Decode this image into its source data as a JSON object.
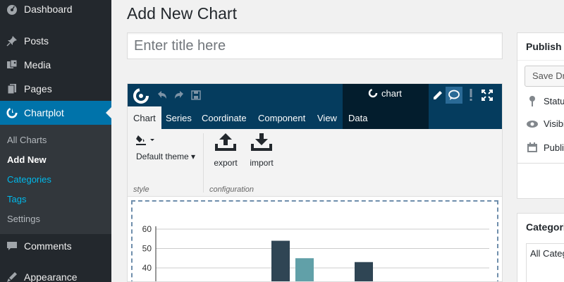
{
  "sidebar": {
    "items": [
      {
        "label": "Dashboard",
        "icon": "dashboard-icon"
      },
      {
        "label": "Posts",
        "icon": "pin-icon"
      },
      {
        "label": "Media",
        "icon": "media-icon"
      },
      {
        "label": "Pages",
        "icon": "pages-icon"
      },
      {
        "label": "Chartplot",
        "icon": "chartplot-icon"
      },
      {
        "label": "Comments",
        "icon": "comments-icon"
      },
      {
        "label": "Appearance",
        "icon": "appearance-icon"
      }
    ],
    "submenu": [
      "All Charts",
      "Add New",
      "Categories",
      "Tags",
      "Settings"
    ]
  },
  "page": {
    "title": "Add New Chart",
    "title_placeholder": "Enter title here"
  },
  "editor": {
    "tabs": [
      "Chart",
      "Series",
      "Coordinate",
      "Component",
      "View",
      "Data"
    ],
    "chart_tab_label": "chart",
    "ribbon": {
      "theme_label": "Default theme",
      "export_label": "export",
      "import_label": "import",
      "group_style": "style",
      "group_configuration": "configuration"
    }
  },
  "chart_data": {
    "type": "bar",
    "y_ticks": [
      40,
      50,
      60
    ],
    "ylim": [
      0,
      60
    ],
    "bars": [
      {
        "value": 54,
        "color": "#2f4554"
      },
      {
        "value": 45,
        "color": "#61a0a8"
      },
      {
        "value": 43,
        "color": "#2f4554"
      }
    ]
  },
  "publish": {
    "title": "Publish",
    "save_draft_label": "Save Draft",
    "status_label": "Status",
    "visibility_label": "Visibility",
    "publish_label": "Publish"
  },
  "categories": {
    "title": "Categories",
    "all_label": "All Categories"
  },
  "colors": {
    "sidebar_bg": "#23282d",
    "accent": "#0073aa",
    "editor_bar": "#053c5e"
  }
}
